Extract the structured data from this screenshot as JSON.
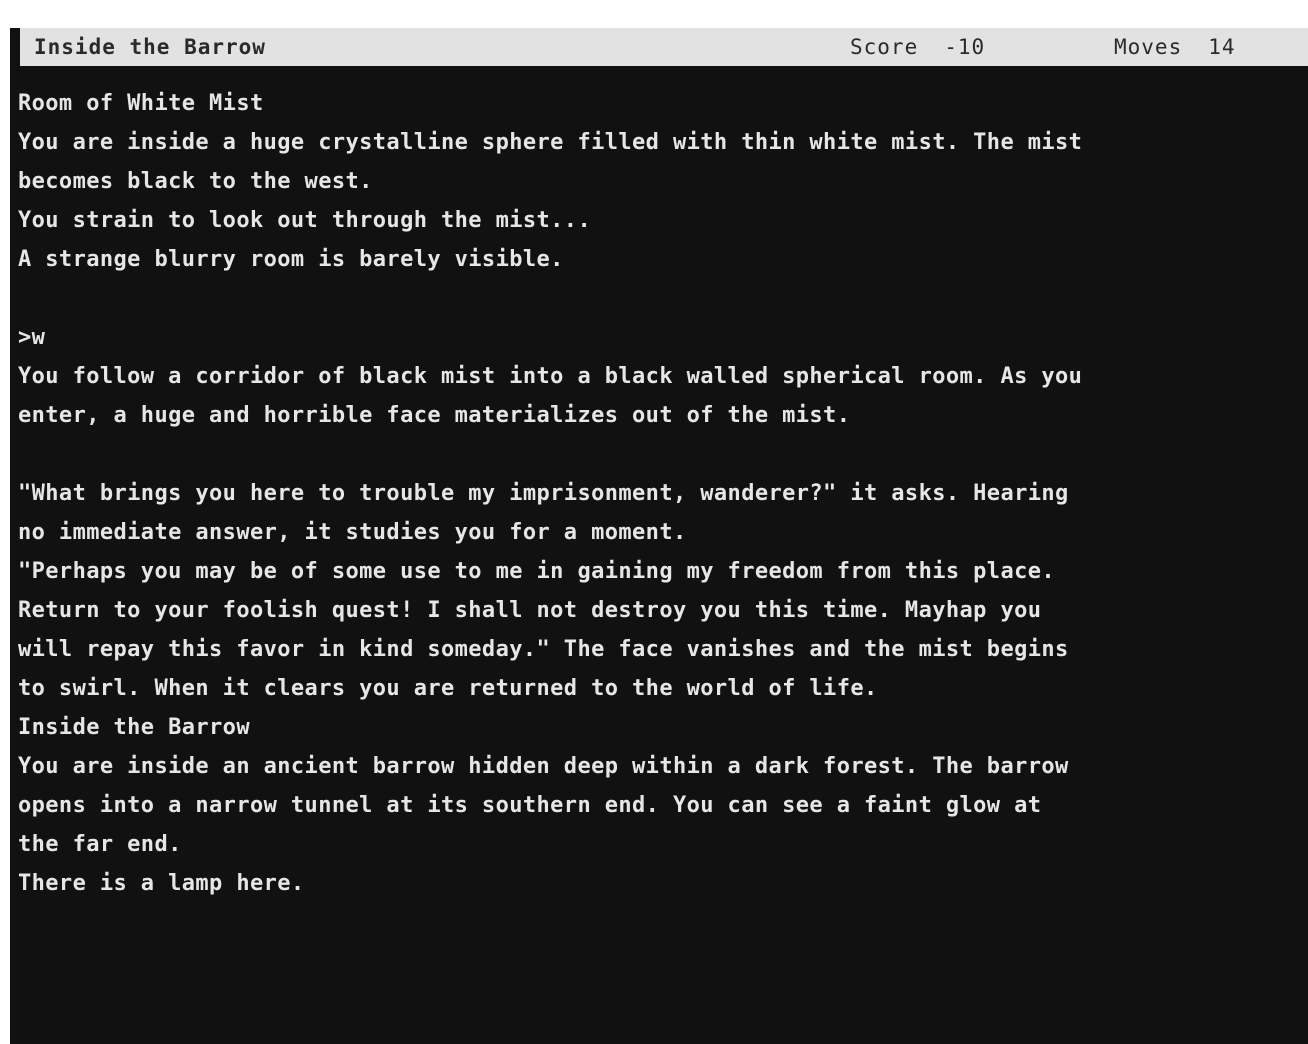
{
  "status_bar": {
    "location": "Inside the Barrow",
    "score_label": "Score",
    "score_value": "-10",
    "moves_label": "Moves",
    "moves_value": "14"
  },
  "transcript": [
    "Room of White Mist",
    "You are inside a huge crystalline sphere filled with thin white mist. The mist",
    "becomes black to the west.",
    "You strain to look out through the mist...",
    "A strange blurry room is barely visible.",
    "",
    ">w",
    "You follow a corridor of black mist into a black walled spherical room. As you",
    "enter, a huge and horrible face materializes out of the mist.",
    "",
    "\"What brings you here to trouble my imprisonment, wanderer?\" it asks. Hearing",
    "no immediate answer, it studies you for a moment.",
    "\"Perhaps you may be of some use to me in gaining my freedom from this place.",
    "Return to your foolish quest! I shall not destroy you this time. Mayhap you",
    "will repay this favor in kind someday.\" The face vanishes and the mist begins",
    "to swirl. When it clears you are returned to the world of life.",
    "Inside the Barrow",
    "You are inside an ancient barrow hidden deep within a dark forest. The barrow",
    "opens into a narrow tunnel at its southern end. You can see a faint glow at",
    "the far end.",
    "There is a lamp here."
  ],
  "colors": {
    "screen_background": "#111111",
    "status_bar_background": "#e2e2e2",
    "status_bar_text": "#2a2a2a",
    "transcript_text": "#e6e6e6"
  }
}
